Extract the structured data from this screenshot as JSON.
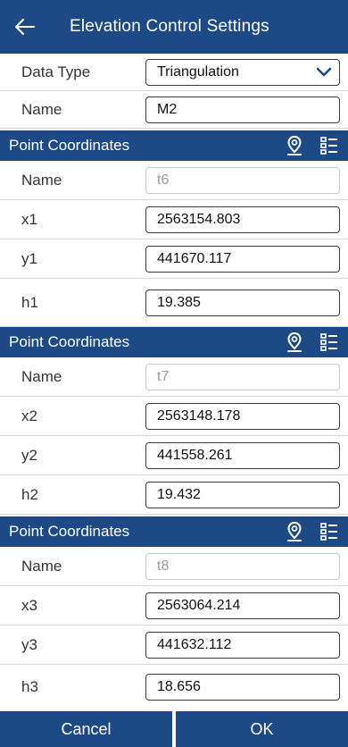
{
  "header": {
    "title": "Elevation Control Settings"
  },
  "data_type": {
    "label": "Data Type",
    "value": "Triangulation"
  },
  "name": {
    "label": "Name",
    "value": "M2"
  },
  "points": [
    {
      "section_title": "Point Coordinates",
      "name_label": "Name",
      "name_value": "t6",
      "x_label": "x1",
      "x_value": "2563154.803",
      "y_label": "y1",
      "y_value": "441670.117",
      "h_label": "h1",
      "h_value": "19.385"
    },
    {
      "section_title": "Point Coordinates",
      "name_label": "Name",
      "name_value": "t7",
      "x_label": "x2",
      "x_value": "2563148.178",
      "y_label": "y2",
      "y_value": "441558.261",
      "h_label": "h2",
      "h_value": "19.432"
    },
    {
      "section_title": "Point Coordinates",
      "name_label": "Name",
      "name_value": "t8",
      "x_label": "x3",
      "x_value": "2563064.214",
      "y_label": "y3",
      "y_value": "441632.112",
      "h_label": "h3",
      "h_value": "18.656"
    }
  ],
  "footer": {
    "cancel_label": "Cancel",
    "ok_label": "OK"
  },
  "colors": {
    "primary": "#1d4a86",
    "accent_icon": "#ffffff"
  }
}
